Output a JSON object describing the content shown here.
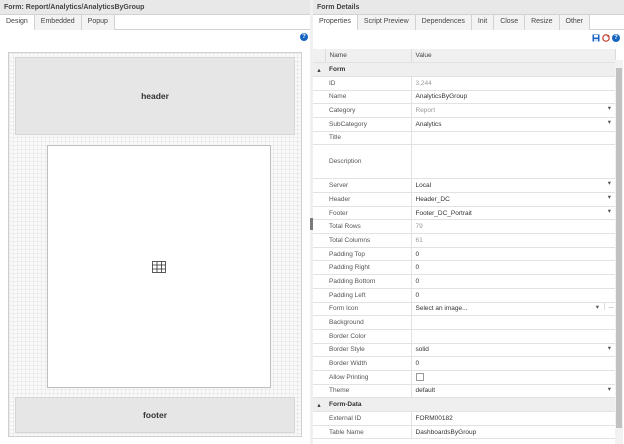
{
  "left": {
    "title": "Form: Report/Analytics/AnalyticsByGroup",
    "tabs": [
      "Design",
      "Embedded",
      "Popup"
    ],
    "help": "?",
    "header_label": "header",
    "footer_label": "footer"
  },
  "right": {
    "title": "Form Details",
    "tabs": [
      "Properties",
      "Script Preview",
      "Dependences",
      "Init",
      "Close",
      "Resize",
      "Other"
    ],
    "help": "?",
    "columns": {
      "name": "Name",
      "value": "Value"
    },
    "groups": {
      "form": "Form",
      "form_data": "Form-Data"
    },
    "rows": [
      {
        "name": "ID",
        "value": "3,244",
        "muted": true
      },
      {
        "name": "Name",
        "value": "AnalyticsByGroup"
      },
      {
        "name": "Category",
        "value": "Report",
        "muted": true,
        "dropdown": "▾"
      },
      {
        "name": "SubCategory",
        "value": "Analytics",
        "dropdown": "▾"
      },
      {
        "name": "Title",
        "value": ""
      },
      {
        "name": "Description",
        "value": ""
      },
      {
        "name": "Server",
        "value": "Local",
        "dropdown": "▾"
      },
      {
        "name": "Header",
        "value": "Header_DC",
        "dropdown": "▾"
      },
      {
        "name": "Footer",
        "value": "Footer_DC_Portrait",
        "dropdown": "▾"
      },
      {
        "name": "Total Rows",
        "value": "79",
        "muted": true
      },
      {
        "name": "Total Columns",
        "value": "61",
        "muted": true
      },
      {
        "name": "Padding Top",
        "value": "0"
      },
      {
        "name": "Padding Right",
        "value": "0"
      },
      {
        "name": "Padding Bottom",
        "value": "0"
      },
      {
        "name": "Padding Left",
        "value": "0"
      },
      {
        "name": "Form Icon",
        "value": "Select an image...",
        "dropdown": "▾",
        "extra": "..."
      },
      {
        "name": "Background",
        "value": ""
      },
      {
        "name": "Border Color",
        "value": ""
      },
      {
        "name": "Border Style",
        "value": "solid",
        "dropdown": "▾"
      },
      {
        "name": "Border Width",
        "value": "0"
      },
      {
        "name": "Allow Printing",
        "value": "",
        "checkbox": true
      },
      {
        "name": "Theme",
        "value": "default",
        "dropdown": "▾"
      }
    ],
    "data_rows": [
      {
        "name": "External ID",
        "value": "FORM00182"
      },
      {
        "name": "Table Name",
        "value": "DashboardsByGroup"
      }
    ]
  },
  "colors": {
    "help_blue": "#1565c0",
    "save_icon": "#1e63c4",
    "refresh_icon": "#c0392b",
    "header_band": "#e6e6e6"
  }
}
